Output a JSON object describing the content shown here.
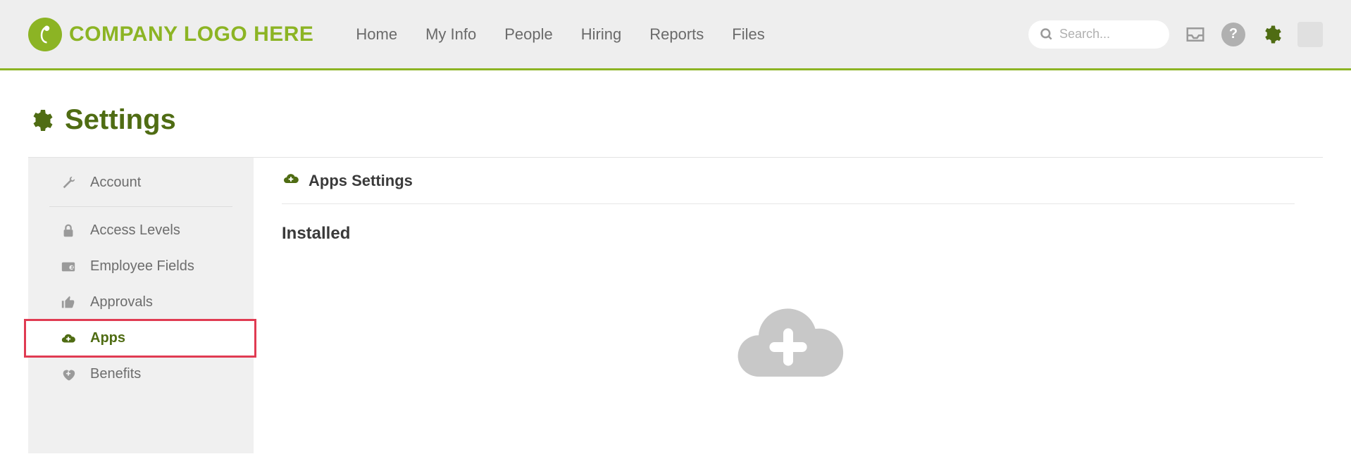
{
  "header": {
    "logo_text": "COMPANY LOGO HERE",
    "nav": [
      "Home",
      "My Info",
      "People",
      "Hiring",
      "Reports",
      "Files"
    ],
    "search_placeholder": "Search..."
  },
  "page": {
    "title": "Settings"
  },
  "sidebar": {
    "items": [
      {
        "label": "Account",
        "icon": "wrench"
      },
      {
        "label": "Access Levels",
        "icon": "lock"
      },
      {
        "label": "Employee Fields",
        "icon": "id-card"
      },
      {
        "label": "Approvals",
        "icon": "thumbs-up"
      },
      {
        "label": "Apps",
        "icon": "cloud-plus",
        "active": true
      },
      {
        "label": "Benefits",
        "icon": "heart-plus"
      }
    ]
  },
  "main": {
    "section_title": "Apps Settings",
    "sub_title": "Installed"
  }
}
